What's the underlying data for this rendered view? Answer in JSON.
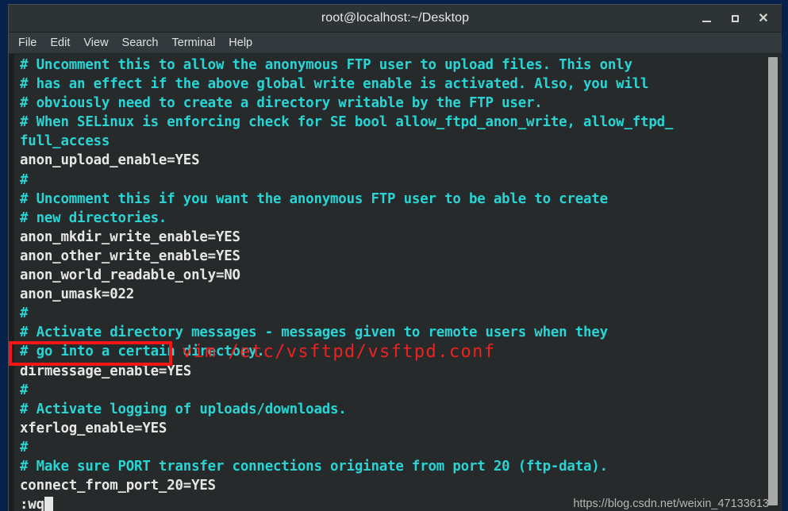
{
  "window": {
    "title": "root@localhost:~/Desktop",
    "controls": [
      {
        "name": "minimize",
        "glyph": ""
      },
      {
        "name": "maximize",
        "glyph": ""
      },
      {
        "name": "close",
        "glyph": "✕"
      }
    ]
  },
  "menubar": {
    "items": [
      "File",
      "Edit",
      "View",
      "Search",
      "Terminal",
      "Help"
    ]
  },
  "terminal": {
    "lines": [
      {
        "type": "comment",
        "text": "# Uncomment this to allow the anonymous FTP user to upload files. This only"
      },
      {
        "type": "comment",
        "text": "# has an effect if the above global write enable is activated. Also, you will"
      },
      {
        "type": "comment",
        "text": "# obviously need to create a directory writable by the FTP user."
      },
      {
        "type": "comment",
        "text": "# When SELinux is enforcing check for SE bool allow_ftpd_anon_write, allow_ftpd_"
      },
      {
        "type": "comment",
        "text": "full_access"
      },
      {
        "type": "setting",
        "text": "anon_upload_enable=YES"
      },
      {
        "type": "comment",
        "text": "#"
      },
      {
        "type": "comment",
        "text": "# Uncomment this if you want the anonymous FTP user to be able to create"
      },
      {
        "type": "comment",
        "text": "# new directories."
      },
      {
        "type": "setting",
        "text": "anon_mkdir_write_enable=YES"
      },
      {
        "type": "setting",
        "text": "anon_other_write_enable=YES"
      },
      {
        "type": "setting",
        "text": "anon_world_readable_only=NO"
      },
      {
        "type": "setting",
        "text": "anon_umask=022"
      },
      {
        "type": "comment",
        "text": "#"
      },
      {
        "type": "comment",
        "text": "# Activate directory messages - messages given to remote users when they"
      },
      {
        "type": "comment",
        "text": "# go into a certain directory."
      },
      {
        "type": "setting",
        "text": "dirmessage_enable=YES"
      },
      {
        "type": "comment",
        "text": "#"
      },
      {
        "type": "comment",
        "text": "# Activate logging of uploads/downloads."
      },
      {
        "type": "setting",
        "text": "xferlog_enable=YES"
      },
      {
        "type": "comment",
        "text": "#"
      },
      {
        "type": "comment",
        "text": "# Make sure PORT transfer connections originate from port 20 (ftp-data)."
      },
      {
        "type": "setting",
        "text": "connect_from_port_20=YES"
      }
    ],
    "command_line": ":wq"
  },
  "annotations": {
    "highlight_target": "anon_umask=022",
    "note_text": "vim /etc/vsftpd/vsftpd.conf",
    "note_color": "#ef2222",
    "box_color": "#f41616"
  },
  "watermark": {
    "text": "https://blog.csdn.net/weixin_47133613"
  },
  "colors": {
    "comment": "#2ad4d4",
    "setting": "#e6e6e6",
    "terminal_bg": "#262a2b",
    "chrome_bg": "#2e3436",
    "desktop_bg": "#07224a"
  }
}
